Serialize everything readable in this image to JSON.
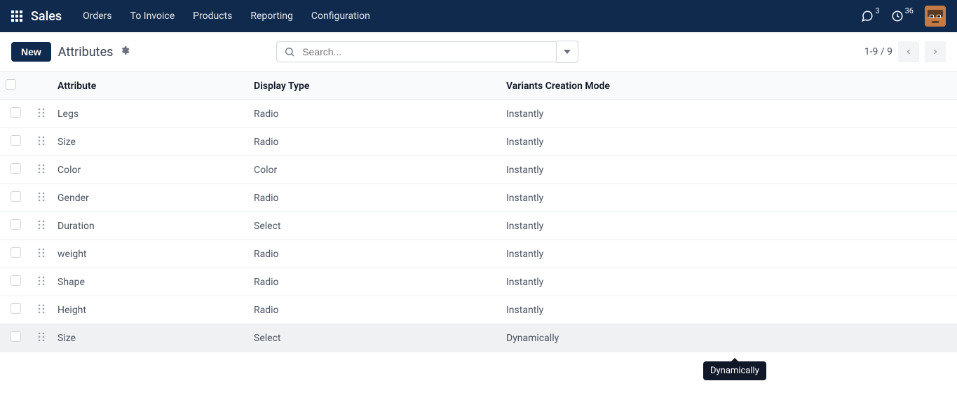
{
  "nav": {
    "brand": "Sales",
    "links": [
      "Orders",
      "To Invoice",
      "Products",
      "Reporting",
      "Configuration"
    ],
    "messages_badge": "3",
    "activities_badge": "36"
  },
  "controls": {
    "new_label": "New",
    "breadcrumb": "Attributes",
    "search_placeholder": "Search...",
    "pager_text": "1-9 / 9"
  },
  "table": {
    "headers": {
      "attribute": "Attribute",
      "display_type": "Display Type",
      "variants_mode": "Variants Creation Mode"
    },
    "rows": [
      {
        "attribute": "Legs",
        "display_type": "Radio",
        "variants_mode": "Instantly",
        "hover": false
      },
      {
        "attribute": "Size",
        "display_type": "Radio",
        "variants_mode": "Instantly",
        "hover": false
      },
      {
        "attribute": "Color",
        "display_type": "Color",
        "variants_mode": "Instantly",
        "hover": false
      },
      {
        "attribute": "Gender",
        "display_type": "Radio",
        "variants_mode": "Instantly",
        "hover": false
      },
      {
        "attribute": "Duration",
        "display_type": "Select",
        "variants_mode": "Instantly",
        "hover": false
      },
      {
        "attribute": "weight",
        "display_type": "Radio",
        "variants_mode": "Instantly",
        "hover": false
      },
      {
        "attribute": "Shape",
        "display_type": "Radio",
        "variants_mode": "Instantly",
        "hover": false
      },
      {
        "attribute": "Height",
        "display_type": "Radio",
        "variants_mode": "Instantly",
        "hover": false
      },
      {
        "attribute": "Size",
        "display_type": "Select",
        "variants_mode": "Dynamically",
        "hover": true
      }
    ]
  },
  "tooltip": {
    "text": "Dynamically"
  }
}
